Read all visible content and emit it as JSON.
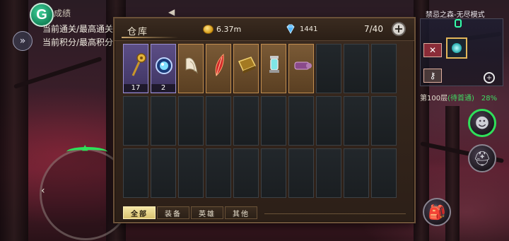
{
  "hud": {
    "app_badge": "G",
    "title": "成绩",
    "line1": "当前通关/最高通关",
    "line2": "当前积分/最高积分"
  },
  "mode": {
    "title": "禁忌之森-无尽模式",
    "floor_label": "第100层",
    "floor_status": "(待首通)",
    "progress": "28%"
  },
  "warehouse": {
    "title": "仓库",
    "gold": "6.37m",
    "gems": "1441",
    "capacity": "7/40",
    "plus": "+",
    "items": [
      {
        "icon": "golden-scepter-icon",
        "rarity": "rare",
        "count": "17"
      },
      {
        "icon": "blue-orb-icon",
        "rarity": "rare",
        "count": "2"
      },
      {
        "icon": "claw-tooth-icon",
        "rarity": "common",
        "count": ""
      },
      {
        "icon": "red-feather-icon",
        "rarity": "common",
        "count": ""
      },
      {
        "icon": "spellbook-icon",
        "rarity": "common",
        "count": ""
      },
      {
        "icon": "lantern-icon",
        "rarity": "common",
        "count": ""
      },
      {
        "icon": "scroll-icon",
        "rarity": "common",
        "count": ""
      }
    ],
    "total_slots": 30,
    "tabs": [
      "全部",
      "装备",
      "英雄",
      "其他"
    ],
    "active_tab": 0
  },
  "colors": {
    "accent_green": "#2fe05a",
    "rare_slot": "#5c4e86",
    "common_slot": "#7a5a36",
    "panel_bg": "#2c1f17"
  }
}
